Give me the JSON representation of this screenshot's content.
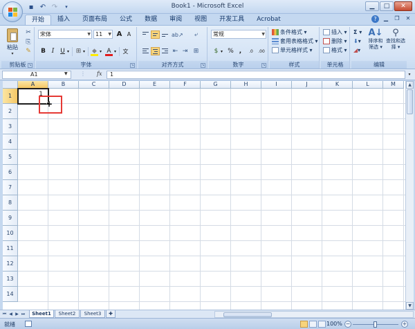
{
  "window": {
    "title": "Book1 - Microsoft Excel",
    "minimize": "▁",
    "maximize": "□",
    "close": "✕"
  },
  "quick_access": {
    "save_icon": "save-icon",
    "undo_icon": "undo-icon",
    "redo_icon": "redo-icon",
    "customize_icon": "chevron-down-icon"
  },
  "tabs": [
    "开始",
    "插入",
    "页面布局",
    "公式",
    "数据",
    "审阅",
    "视图",
    "开发工具",
    "Acrobat"
  ],
  "active_tab": "开始",
  "ribbon": {
    "clipboard": {
      "label": "剪贴板",
      "paste": "粘贴",
      "cut": "✂",
      "copy": "⎘",
      "format_painter": "🖌"
    },
    "font": {
      "label": "字体",
      "font_name": "宋体",
      "font_size": "11",
      "grow": "A",
      "shrink": "A",
      "bold": "B",
      "italic": "I",
      "underline": "U",
      "border": "⊞",
      "fill_color": "◆",
      "font_color": "A",
      "phonetic": "文"
    },
    "alignment": {
      "label": "对齐方式"
    },
    "number": {
      "label": "数字",
      "format": "常规",
      "currency": "$",
      "percent": "%",
      "comma": ",",
      "inc_decimal": ".0",
      "dec_decimal": ".00"
    },
    "styles": {
      "label": "样式",
      "conditional": "条件格式 ▾",
      "table_format": "套用表格格式 ▾",
      "cell_styles": "单元格样式 ▾"
    },
    "cells": {
      "label": "单元格",
      "insert": "插入 ▾",
      "delete": "删除 ▾",
      "format": "格式 ▾"
    },
    "editing": {
      "label": "编辑",
      "autosum": "Σ ▾",
      "fill": "▾",
      "clear": "▾",
      "sort_filter": "排序和筛选 ▾",
      "find_select": "查找和选择 ▾"
    }
  },
  "formula_bar": {
    "name_box": "A1",
    "fx": "fx",
    "value": "1"
  },
  "grid": {
    "columns": [
      "A",
      "B",
      "C",
      "D",
      "E",
      "F",
      "G",
      "H",
      "I",
      "J",
      "K",
      "L",
      "M"
    ],
    "rows": [
      "1",
      "2",
      "3",
      "4",
      "5",
      "6",
      "7",
      "8",
      "9",
      "10",
      "11",
      "12",
      "13",
      "14"
    ],
    "active_cell": "A1",
    "active_value": "1"
  },
  "sheets": [
    "Sheet1",
    "Sheet2",
    "Sheet3"
  ],
  "active_sheet": "Sheet1",
  "status": {
    "mode": "就绪",
    "zoom": "100%"
  },
  "colors": {
    "ribbon": "#dbe7f7",
    "selection": "#f5c765",
    "highlight": "#e53935"
  }
}
